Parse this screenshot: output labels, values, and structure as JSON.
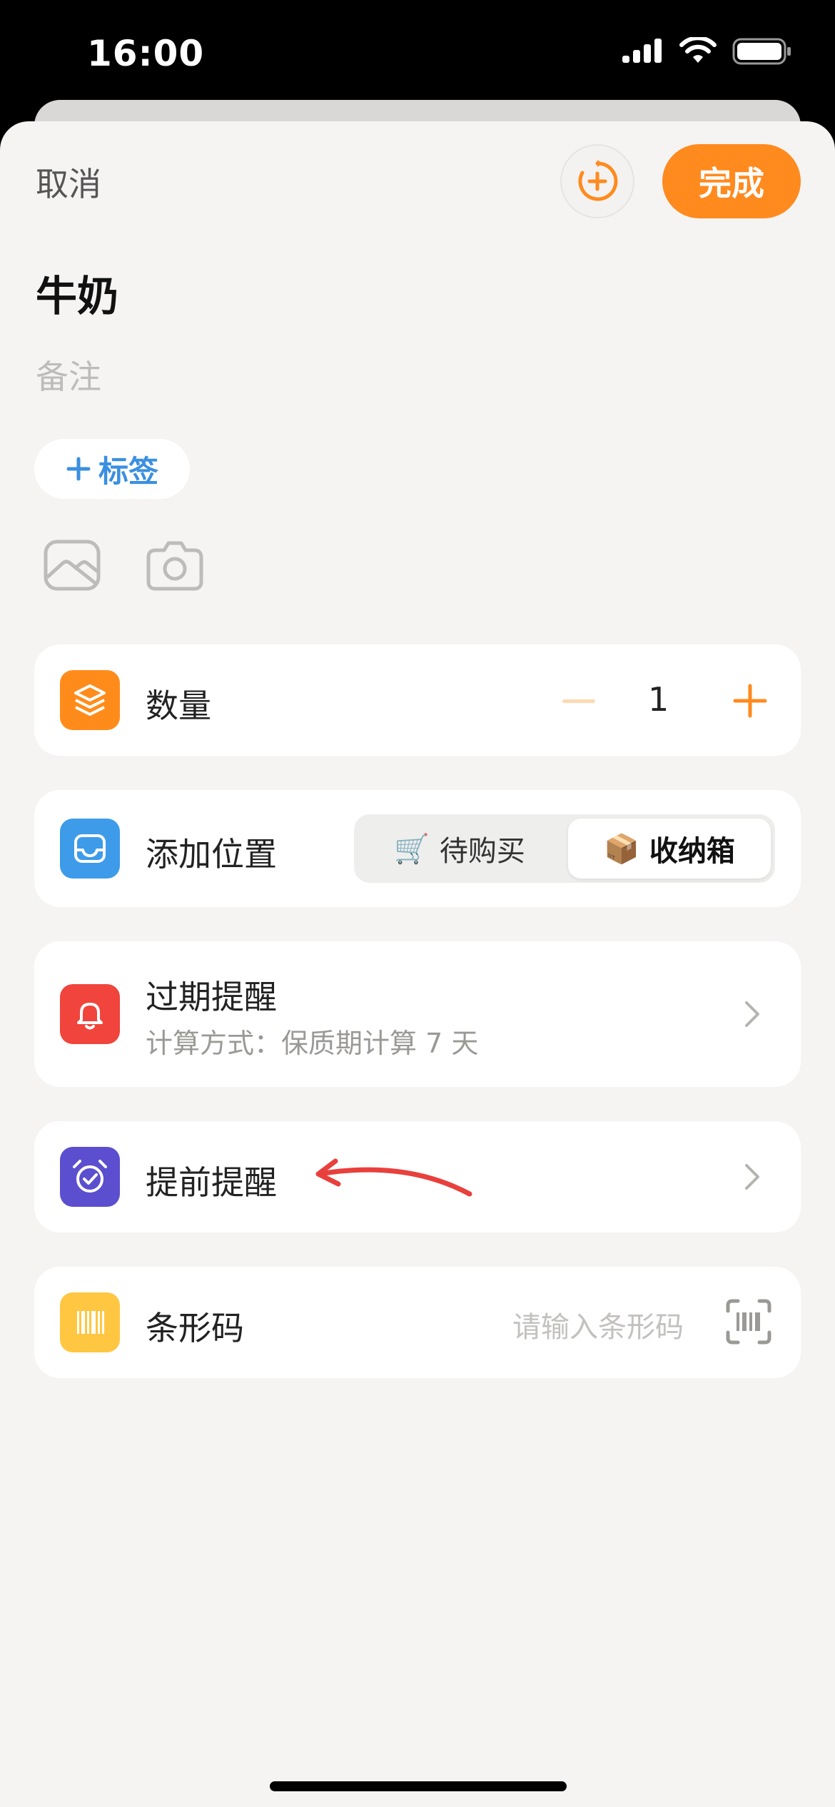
{
  "status_bar": {
    "time": "16:00"
  },
  "header": {
    "cancel_label": "取消",
    "done_label": "完成",
    "refresh_icon": "refresh-add-icon"
  },
  "item": {
    "name": "牛奶",
    "note_placeholder": "备注",
    "tag_label": "标签"
  },
  "media": {
    "gallery_icon": "image-icon",
    "camera_icon": "camera-icon"
  },
  "quantity": {
    "label": "数量",
    "value": "1"
  },
  "location": {
    "label": "添加位置",
    "options": [
      {
        "emoji": "🛒",
        "label": "待购买",
        "selected": false
      },
      {
        "emoji": "📦",
        "label": "收纳箱",
        "selected": true
      }
    ]
  },
  "expiry": {
    "title": "过期提醒",
    "subtitle": "计算方式：保质期计算 7 天"
  },
  "advance": {
    "title": "提前提醒"
  },
  "barcode": {
    "label": "条形码",
    "placeholder": "请输入条形码"
  },
  "colors": {
    "accent_orange": "#ff8a1e",
    "quantity_icon": "#ff8c1a",
    "location_icon": "#3d9be9",
    "expiry_icon": "#f0443c",
    "advance_icon": "#5b4fcf",
    "barcode_icon": "#ffc642",
    "annotation_arrow": "#e8403c"
  }
}
